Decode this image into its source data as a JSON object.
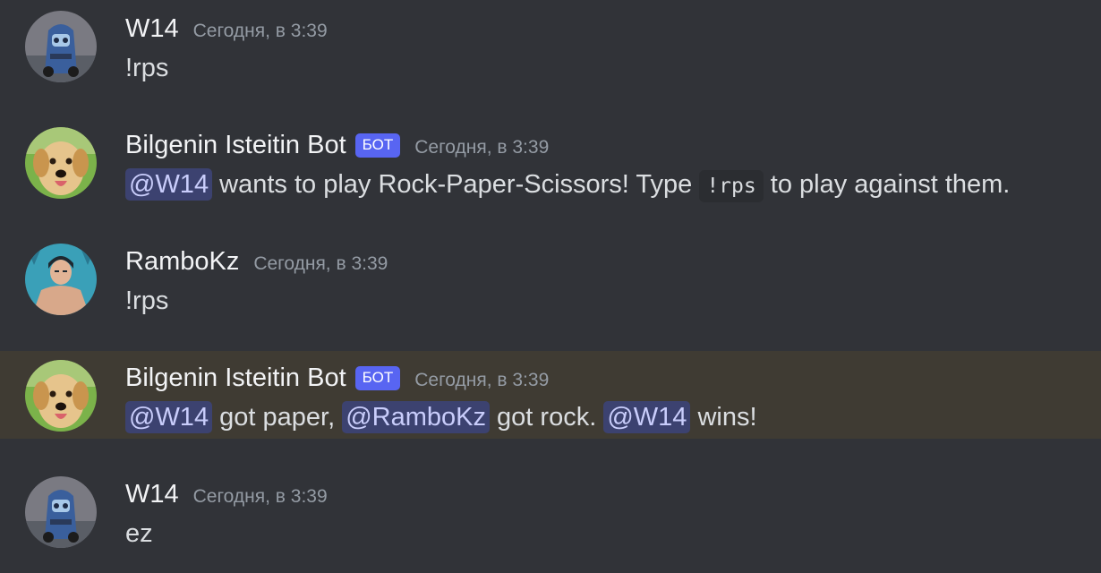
{
  "messages": [
    {
      "author": "W14",
      "timestamp": "Сегодня, в 3:39",
      "text": "!rps",
      "avatar": "cars-character-avatar"
    },
    {
      "author": "Bilgenin Isteitin Bot",
      "bot_tag": "БОТ",
      "timestamp": "Сегодня, в 3:39",
      "avatar": "golden-retriever-avatar",
      "parts": {
        "mention1": "@W14",
        "text1": " wants to play Rock-Paper-Scissors! Type ",
        "code": "!rps",
        "text2": " to play against them."
      }
    },
    {
      "author": "RamboKz",
      "timestamp": "Сегодня, в 3:39",
      "text": "!rps",
      "avatar": "anime-character-avatar"
    },
    {
      "author": "Bilgenin Isteitin Bot",
      "bot_tag": "БОТ",
      "timestamp": "Сегодня, в 3:39",
      "avatar": "golden-retriever-avatar",
      "highlighted": true,
      "parts": {
        "mention1": "@W14",
        "text1": " got paper, ",
        "mention2": "@RamboKz",
        "text2": " got rock. ",
        "mention3": "@W14",
        "text3": " wins!"
      }
    },
    {
      "author": "W14",
      "timestamp": "Сегодня, в 3:39",
      "text": "ez",
      "avatar": "cars-character-avatar"
    }
  ],
  "colors": {
    "background": "#313338",
    "highlight_background": "#3f3b33",
    "bot_tag": "#5865f2",
    "mention_bg": "#3c4270",
    "mention_text": "#c9cdfb"
  }
}
